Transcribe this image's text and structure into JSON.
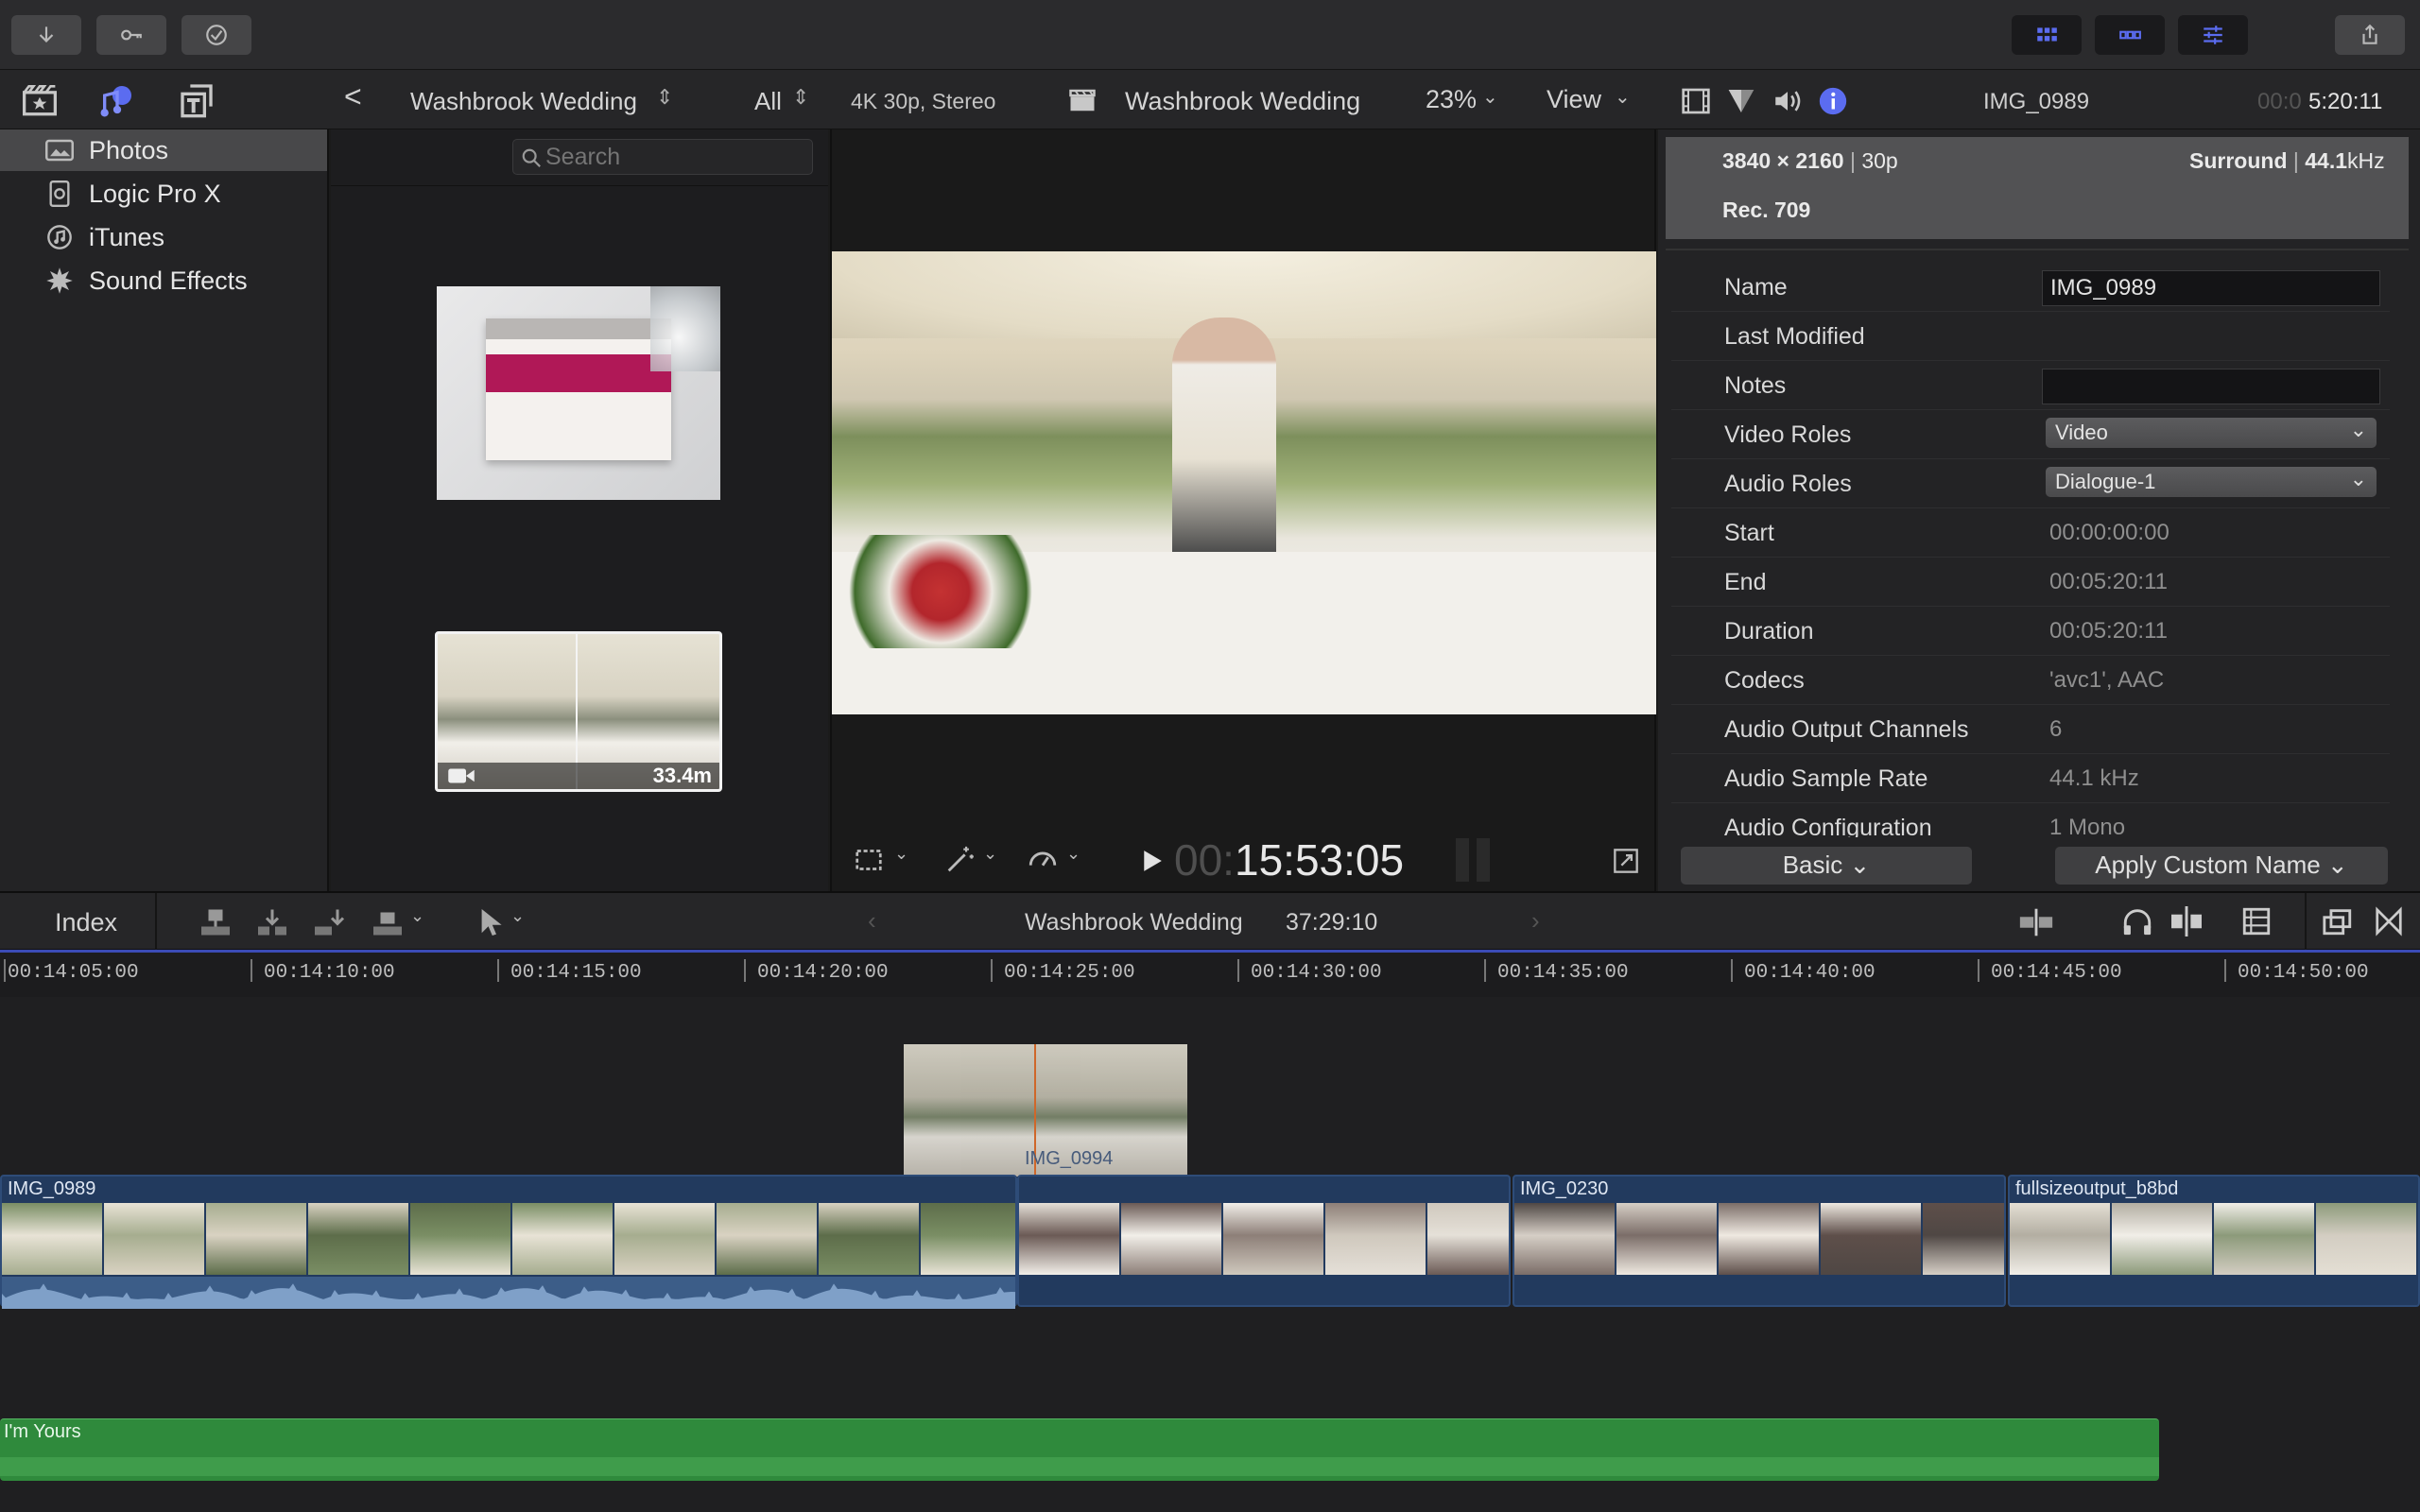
{
  "toolbar": {
    "import_icon": "download-arrow-icon",
    "keywords_icon": "key-icon",
    "background_tasks_icon": "checkmark-circle-icon",
    "share_icon": "share-icon"
  },
  "library_bar": {
    "back_label": "<",
    "event_name": "Washbrook Wedding",
    "filter_label": "All",
    "format_info": "4K 30p, Stereo",
    "project_name": "Washbrook Wedding",
    "zoom_label": "23%",
    "view_label": "View",
    "clip_name": "IMG_0989",
    "timecode_dim": "00:0",
    "timecode_bright": "5:20:11"
  },
  "sidebar": {
    "items": [
      {
        "label": "Photos",
        "icon": "photos-icon",
        "selected": true
      },
      {
        "label": "Logic Pro X",
        "icon": "logic-icon",
        "selected": false
      },
      {
        "label": "iTunes",
        "icon": "itunes-icon",
        "selected": false
      },
      {
        "label": "Sound Effects",
        "icon": "sound-effects-icon",
        "selected": false
      }
    ]
  },
  "browser": {
    "search_placeholder": "Search",
    "thumb2_duration": "33.4m"
  },
  "viewer": {
    "timecode_dim": "00:",
    "timecode_bright": "15:53:05"
  },
  "inspector": {
    "resolution": "3840 × 2160",
    "frame_rate": "30p",
    "audio_layout": "Surround",
    "sample_rate": "44.1",
    "sample_unit": "kHz",
    "color_space": "Rec. 709",
    "rows": [
      {
        "label": "Name",
        "value": "IMG_0989",
        "kind": "field"
      },
      {
        "label": "Last Modified",
        "value": "",
        "kind": "plain"
      },
      {
        "label": "Notes",
        "value": "",
        "kind": "field"
      },
      {
        "label": "Video Roles",
        "value": "Video",
        "kind": "select"
      },
      {
        "label": "Audio Roles",
        "value": "Dialogue-1",
        "kind": "select"
      },
      {
        "label": "Start",
        "value": "00:00:00:00",
        "kind": "plain"
      },
      {
        "label": "End",
        "value": "00:05:20:11",
        "kind": "plain"
      },
      {
        "label": "Duration",
        "value": "00:05:20:11",
        "kind": "plain"
      },
      {
        "label": "Codecs",
        "value": "'avc1', AAC",
        "kind": "plain"
      },
      {
        "label": "Audio Output Channels",
        "value": "6",
        "kind": "plain"
      },
      {
        "label": "Audio Sample Rate",
        "value": "44.1 kHz",
        "kind": "plain"
      },
      {
        "label": "Audio Configuration",
        "value": "1 Mono",
        "kind": "plain"
      }
    ],
    "basic_label": "Basic",
    "apply_label": "Apply Custom Name"
  },
  "timeline_bar": {
    "index_label": "Index",
    "project_name": "Washbrook Wedding",
    "duration": "37:29:10"
  },
  "ruler": {
    "labels": [
      "00:14:05:00",
      "00:14:10:00",
      "00:14:15:00",
      "00:14:20:00",
      "00:14:25:00",
      "00:14:30:00",
      "00:14:35:00",
      "00:14:40:00",
      "00:14:45:00",
      "00:14:50:00"
    ]
  },
  "timeline": {
    "clips": [
      {
        "name": "IMG_0989"
      },
      {
        "name": ""
      },
      {
        "name": "IMG_0230"
      },
      {
        "name": "fullsizeoutput_b8bd"
      }
    ],
    "ghost_clip_name": "IMG_0994",
    "music_clip_name": "I'm Yours"
  },
  "colors": {
    "accent_blue": "#5b6cf0",
    "video_clip": "#223a5e",
    "music_clip": "#2f8a3c",
    "playhead": "#e8722c"
  }
}
